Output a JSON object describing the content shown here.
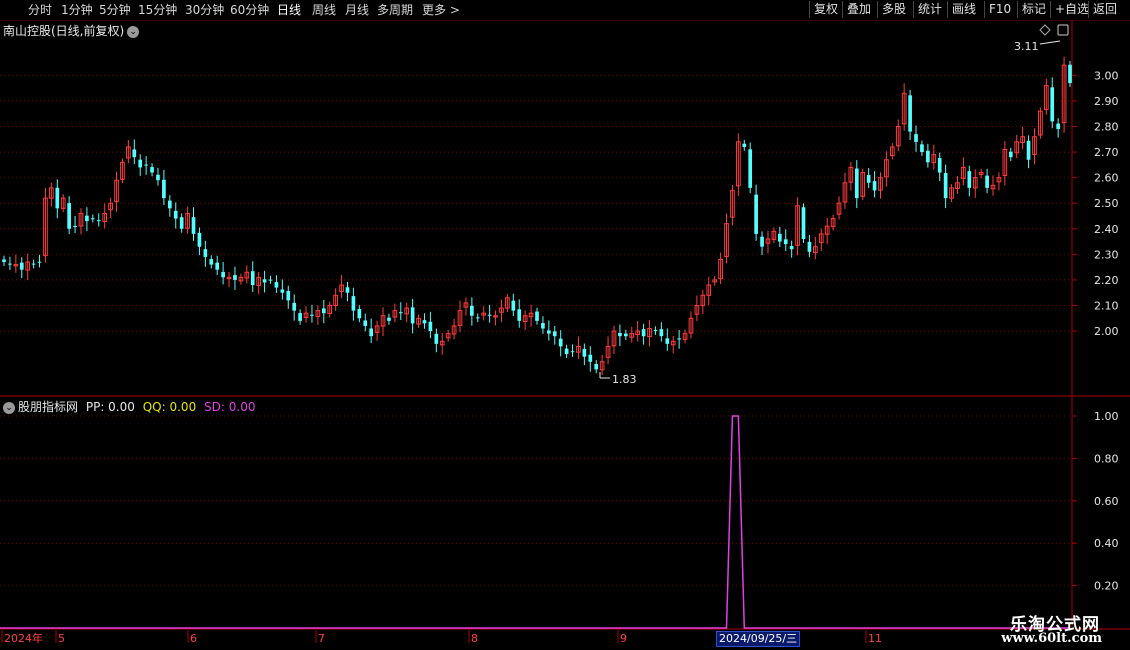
{
  "toolbar": {
    "timeframes": [
      "分时",
      "1分钟",
      "5分钟",
      "15分钟",
      "30分钟",
      "60分钟",
      "日线",
      "周线",
      "月线",
      "多周期",
      "更多 >"
    ],
    "active_timeframe": "日线",
    "buttons": [
      "复权",
      "叠加",
      "多股",
      "统计",
      "画线",
      "F10",
      "标记",
      "+自选",
      "返回"
    ]
  },
  "stock": {
    "title": "南山控股(日线,前复权)"
  },
  "indicator": {
    "name": "股朋指标网",
    "pp": "PP: 0.00",
    "qq": "QQ: 0.00",
    "sd": "SD: 0.00",
    "colors": {
      "pp": "#e6e6e6",
      "qq": "#e6e600",
      "sd": "#e040e0"
    }
  },
  "annotations": {
    "high": "3.11",
    "low": "1.83"
  },
  "price_axis": [
    "3.00",
    "2.90",
    "2.80",
    "2.70",
    "2.60",
    "2.50",
    "2.40",
    "2.30",
    "2.20",
    "2.10",
    "2.00"
  ],
  "indicator_axis": [
    "1.00",
    "0.80",
    "0.60",
    "0.40",
    "0.20"
  ],
  "date_axis": [
    "2024年",
    "5",
    "6",
    "7",
    "8",
    "9",
    "11"
  ],
  "cursor_date": "2024/09/25/三",
  "watermark": {
    "line1": "乐淘公式网",
    "line2": "www.60lt.com"
  },
  "colors": {
    "up": "#ff3c3c",
    "down": "#54ffff",
    "grid": "#7a0000",
    "border": "#b00000"
  },
  "chart_data": {
    "type": "candlestick",
    "price_range": [
      1.75,
      3.15
    ],
    "closes": [
      2.27,
      2.26,
      2.26,
      2.24,
      2.27,
      2.26,
      2.27,
      2.52,
      2.56,
      2.48,
      2.52,
      2.4,
      2.41,
      2.46,
      2.43,
      2.44,
      2.43,
      2.46,
      2.5,
      2.59,
      2.66,
      2.72,
      2.68,
      2.64,
      2.65,
      2.62,
      2.59,
      2.52,
      2.48,
      2.44,
      2.4,
      2.46,
      2.38,
      2.33,
      2.29,
      2.26,
      2.24,
      2.21,
      2.21,
      2.2,
      2.21,
      2.23,
      2.18,
      2.21,
      2.19,
      2.2,
      2.17,
      2.15,
      2.12,
      2.08,
      2.04,
      2.07,
      2.06,
      2.08,
      2.07,
      2.1,
      2.14,
      2.18,
      2.15,
      2.08,
      2.05,
      2.02,
      1.98,
      2.02,
      2.06,
      2.04,
      2.08,
      2.07,
      2.09,
      2.03,
      2.05,
      2.03,
      2.0,
      1.95,
      1.96,
      1.99,
      2.02,
      2.08,
      2.11,
      2.06,
      2.05,
      2.07,
      2.06,
      2.06,
      2.09,
      2.13,
      2.08,
      2.04,
      2.06,
      2.07,
      2.04,
      2.01,
      1.99,
      1.98,
      1.94,
      1.91,
      1.92,
      1.94,
      1.9,
      1.88,
      1.85,
      1.88,
      1.94,
      2.0,
      1.98,
      1.98,
      1.99,
      2.0,
      1.98,
      2.01,
      2.0,
      1.98,
      1.95,
      1.96,
      1.97,
      1.99,
      2.05,
      2.1,
      2.14,
      2.18,
      2.2,
      2.28,
      2.42,
      2.55,
      2.74,
      2.72,
      2.56,
      2.38,
      2.33,
      2.36,
      2.39,
      2.35,
      2.34,
      2.32,
      2.49,
      2.36,
      2.31,
      2.33,
      2.38,
      2.41,
      2.44,
      2.5,
      2.58,
      2.64,
      2.52,
      2.62,
      2.58,
      2.55,
      2.6,
      2.67,
      2.72,
      2.8,
      2.93,
      2.78,
      2.74,
      2.7,
      2.66,
      2.69,
      2.62,
      2.52,
      2.56,
      2.58,
      2.64,
      2.56,
      2.6,
      2.62,
      2.56,
      2.57,
      2.6,
      2.71,
      2.68,
      2.74,
      2.76,
      2.67,
      2.76,
      2.86,
      2.96,
      2.82,
      2.79,
      3.04,
      2.97
    ]
  }
}
